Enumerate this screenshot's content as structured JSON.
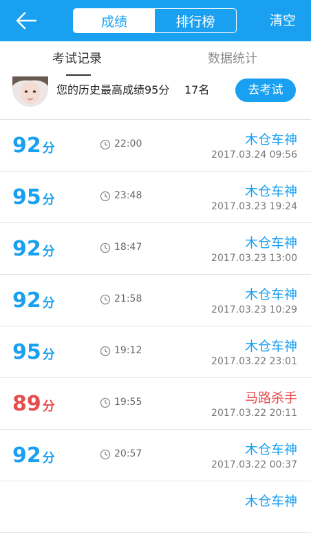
{
  "header": {
    "tabs": [
      {
        "label": "成绩",
        "active": true
      },
      {
        "label": "排行榜",
        "active": false
      }
    ],
    "clear_label": "清空",
    "back_icon": "back-arrow-icon"
  },
  "subtabs": [
    {
      "label": "考试记录",
      "active": true
    },
    {
      "label": "数据统计",
      "active": false
    }
  ],
  "summary": {
    "text": "您的历史最高成绩95分",
    "rank": "17名",
    "button_label": "去考试"
  },
  "colors": {
    "primary": "#1aa0f0",
    "score_blue": "#1aa0f0",
    "score_red": "#e94c4c",
    "title_blue": "#1aa0f0",
    "title_red": "#e94c4c"
  },
  "records": [
    {
      "score": "92",
      "unit": "分",
      "time": "22:00",
      "title": "木仓车神",
      "date": "2017.03.24  09:56",
      "status": "pass"
    },
    {
      "score": "95",
      "unit": "分",
      "time": "23:48",
      "title": "木仓车神",
      "date": "2017.03.23  19:24",
      "status": "pass"
    },
    {
      "score": "92",
      "unit": "分",
      "time": "18:47",
      "title": "木仓车神",
      "date": "2017.03.23  13:00",
      "status": "pass"
    },
    {
      "score": "92",
      "unit": "分",
      "time": "21:58",
      "title": "木仓车神",
      "date": "2017.03.23  10:29",
      "status": "pass"
    },
    {
      "score": "95",
      "unit": "分",
      "time": "19:12",
      "title": "木仓车神",
      "date": "2017.03.22  23:01",
      "status": "pass"
    },
    {
      "score": "89",
      "unit": "分",
      "time": "19:55",
      "title": "马路杀手",
      "date": "2017.03.22  20:11",
      "status": "fail"
    },
    {
      "score": "92",
      "unit": "分",
      "time": "20:57",
      "title": "木仓车神",
      "date": "2017.03.22  00:37",
      "status": "pass"
    },
    {
      "score": "",
      "unit": "",
      "time": "",
      "title": "木仓车神",
      "date": "",
      "status": "pass"
    }
  ]
}
